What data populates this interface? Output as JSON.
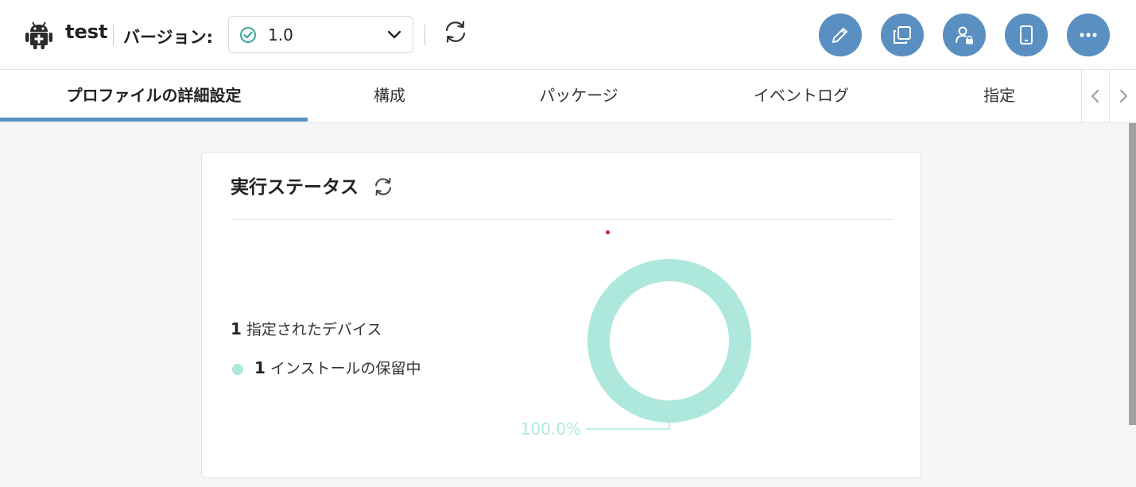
{
  "header": {
    "app_name": "test",
    "version_label": "バージョン:",
    "version_value": "1.0",
    "icons": {
      "app": "android-icon",
      "version_status": "check-circle-icon",
      "dropdown": "chevron-down-icon",
      "refresh": "refresh-icon"
    },
    "actions": [
      {
        "name": "edit-button",
        "icon": "pencil-icon"
      },
      {
        "name": "copy-button",
        "icon": "copy-icon"
      },
      {
        "name": "user-permissions-button",
        "icon": "user-lock-icon"
      },
      {
        "name": "device-button",
        "icon": "phone-icon"
      },
      {
        "name": "more-button",
        "icon": "more-horizontal-icon"
      }
    ]
  },
  "tabs": [
    {
      "label": "プロファイルの詳細設定",
      "active": true
    },
    {
      "label": "構成",
      "active": false
    },
    {
      "label": "パッケージ",
      "active": false
    },
    {
      "label": "イベントログ",
      "active": false
    },
    {
      "label": "指定",
      "active": false
    }
  ],
  "status_card": {
    "title": "実行ステータス",
    "assigned": {
      "count": "1",
      "label": "指定されたデバイス"
    },
    "pending": {
      "count": "1",
      "label": "インストールの保留中"
    }
  },
  "chart_data": {
    "type": "pie",
    "donut": true,
    "slices": [
      {
        "label": "インストールの保留中",
        "value": 100.0,
        "color": "#aee8dc"
      }
    ],
    "data_labels": [
      "100.0%"
    ]
  },
  "colors": {
    "accent": "#5a8fc1",
    "pending": "#aee8dc",
    "check": "#3aa89a"
  }
}
